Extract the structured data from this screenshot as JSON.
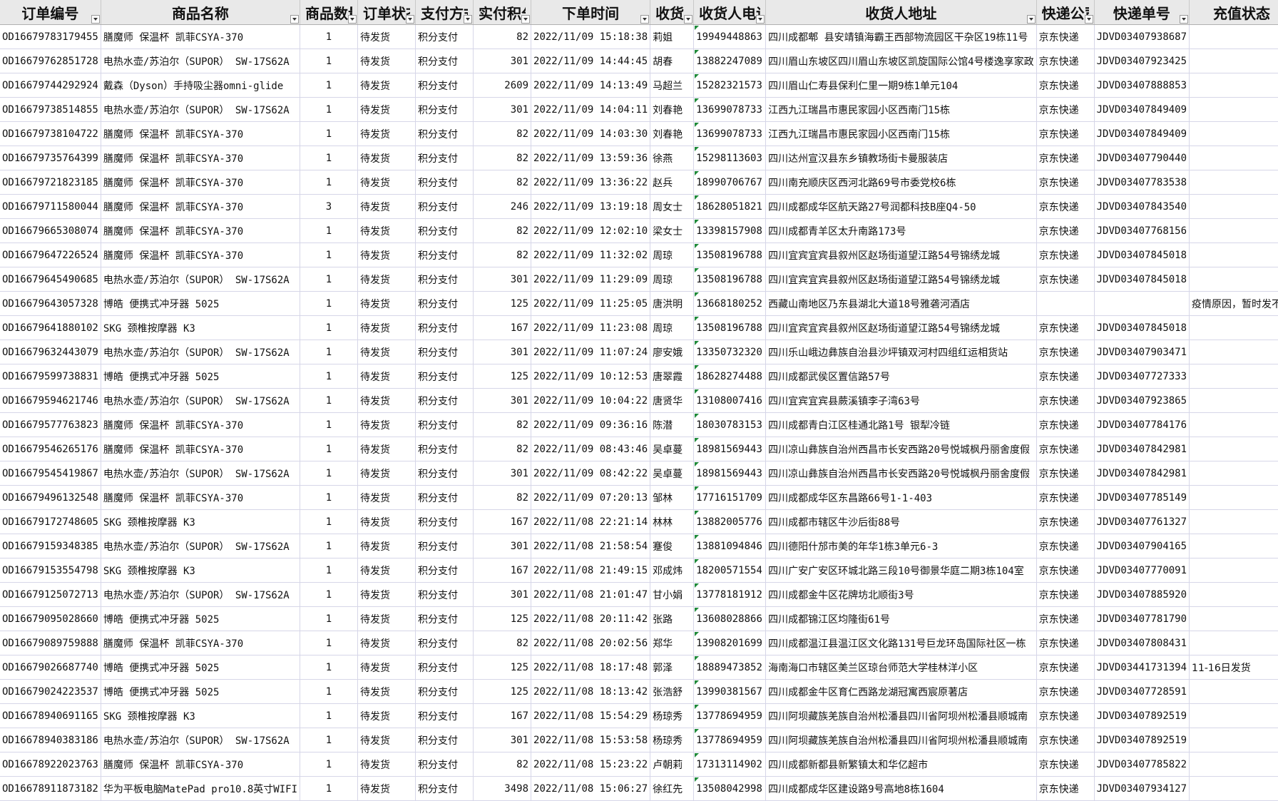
{
  "columns": [
    {
      "key": "order_id",
      "label": "订单编号"
    },
    {
      "key": "product",
      "label": "商品名称"
    },
    {
      "key": "qty",
      "label": "商品数量"
    },
    {
      "key": "status",
      "label": "订单状态"
    },
    {
      "key": "payment",
      "label": "支付方式"
    },
    {
      "key": "points",
      "label": "实付积分"
    },
    {
      "key": "time",
      "label": "下单时间"
    },
    {
      "key": "name",
      "label": "收货人"
    },
    {
      "key": "phone",
      "label": "收货人电话"
    },
    {
      "key": "address",
      "label": "收货人地址"
    },
    {
      "key": "courier",
      "label": "快递公司"
    },
    {
      "key": "tracking",
      "label": "快递单号"
    },
    {
      "key": "recharge",
      "label": "充值状态"
    }
  ],
  "rows": [
    [
      "OD16679783179455",
      "膳魔师 保温杯 凯菲CSYA-370",
      "1",
      "待发货",
      "积分支付",
      "82",
      "2022/11/09 15:18:38",
      "莉姐",
      "19949448863",
      "四川成都郫  县安靖镇海霸王西部物流园区干杂区19栋11号",
      "京东快递",
      "JDVD03407938687",
      ""
    ],
    [
      "OD16679762851728",
      "电热水壶/苏泊尔（SUPOR） SW-17S62A",
      "1",
      "待发货",
      "积分支付",
      "301",
      "2022/11/09 14:44:45",
      "胡春",
      "13882247089",
      "四川眉山东坡区四川眉山东坡区凯旋国际公馆4号楼逸享家政",
      "京东快递",
      "JDVD03407923425",
      ""
    ],
    [
      "OD16679744292924",
      "戴森（Dyson）手持吸尘器omni-glide",
      "1",
      "待发货",
      "积分支付",
      "2609",
      "2022/11/09 14:13:49",
      "马超兰",
      "15282321573",
      "四川眉山仁寿县保利仁里一期9栋1单元104",
      "京东快递",
      "JDVD03407888853",
      ""
    ],
    [
      "OD16679738514855",
      "电热水壶/苏泊尔（SUPOR） SW-17S62A",
      "1",
      "待发货",
      "积分支付",
      "301",
      "2022/11/09 14:04:11",
      "刘春艳",
      "13699078733",
      "江西九江瑞昌市惠民家园小区西南门15栋",
      "京东快递",
      "JDVD03407849409",
      ""
    ],
    [
      "OD16679738104722",
      "膳魔师 保温杯 凯菲CSYA-370",
      "1",
      "待发货",
      "积分支付",
      "82",
      "2022/11/09 14:03:30",
      "刘春艳",
      "13699078733",
      "江西九江瑞昌市惠民家园小区西南门15栋",
      "京东快递",
      "JDVD03407849409",
      ""
    ],
    [
      "OD16679735764399",
      "膳魔师 保温杯 凯菲CSYA-370",
      "1",
      "待发货",
      "积分支付",
      "82",
      "2022/11/09 13:59:36",
      "徐燕",
      "15298113603",
      "四川达州宣汉县东乡镇教场街卡曼服装店",
      "京东快递",
      "JDVD03407790440",
      ""
    ],
    [
      "OD16679721823185",
      "膳魔师 保温杯 凯菲CSYA-370",
      "1",
      "待发货",
      "积分支付",
      "82",
      "2022/11/09 13:36:22",
      "赵兵",
      "18990706767",
      "四川南充顺庆区西河北路69号市委党校6栋",
      "京东快递",
      "JDVD03407783538",
      ""
    ],
    [
      "OD16679711580044",
      "膳魔师 保温杯 凯菲CSYA-370",
      "3",
      "待发货",
      "积分支付",
      "246",
      "2022/11/09 13:19:18",
      "周女士",
      "18628051821",
      "四川成都成华区航天路27号润都科技B座Q4-50",
      "京东快递",
      "JDVD03407843540",
      ""
    ],
    [
      "OD16679665308074",
      "膳魔师 保温杯 凯菲CSYA-370",
      "1",
      "待发货",
      "积分支付",
      "82",
      "2022/11/09 12:02:10",
      "梁女士",
      "13398157908",
      "四川成都青羊区太升南路173号",
      "京东快递",
      "JDVD03407768156",
      ""
    ],
    [
      "OD16679647226524",
      "膳魔师 保温杯 凯菲CSYA-370",
      "1",
      "待发货",
      "积分支付",
      "82",
      "2022/11/09 11:32:02",
      "周琼",
      "13508196788",
      "四川宜宾宜宾县叙州区赵场街道望江路54号锦绣龙城",
      "京东快递",
      "JDVD03407845018",
      ""
    ],
    [
      "OD16679645490685",
      "电热水壶/苏泊尔（SUPOR） SW-17S62A",
      "1",
      "待发货",
      "积分支付",
      "301",
      "2022/11/09 11:29:09",
      "周琼",
      "13508196788",
      "四川宜宾宜宾县叙州区赵场街道望江路54号锦绣龙城",
      "京东快递",
      "JDVD03407845018",
      ""
    ],
    [
      "OD16679643057328",
      "博皓 便携式冲牙器 5025",
      "1",
      "待发货",
      "积分支付",
      "125",
      "2022/11/09 11:25:05",
      "唐洪明",
      "13668180252",
      "西藏山南地区乃东县湖北大道18号雅砻河酒店",
      "",
      "",
      "疫情原因，暂时发不了"
    ],
    [
      "OD16679641880102",
      "SKG 颈椎按摩器 K3",
      "1",
      "待发货",
      "积分支付",
      "167",
      "2022/11/09 11:23:08",
      "周琼",
      "13508196788",
      "四川宜宾宜宾县叙州区赵场街道望江路54号锦绣龙城",
      "京东快递",
      "JDVD03407845018",
      ""
    ],
    [
      "OD16679632443079",
      "电热水壶/苏泊尔（SUPOR） SW-17S62A",
      "1",
      "待发货",
      "积分支付",
      "301",
      "2022/11/09 11:07:24",
      "廖安娥",
      "13350732320",
      "四川乐山峨边彝族自治县沙坪镇双河村四组红运相货站",
      "京东快递",
      "JDVD03407903471",
      ""
    ],
    [
      "OD16679599738831",
      "博皓 便携式冲牙器 5025",
      "1",
      "待发货",
      "积分支付",
      "125",
      "2022/11/09 10:12:53",
      "唐翠霞",
      "18628274488",
      "四川成都武侯区置信路57号",
      "京东快递",
      "JDVD03407727333",
      ""
    ],
    [
      "OD16679594621746",
      "电热水壶/苏泊尔（SUPOR） SW-17S62A",
      "1",
      "待发货",
      "积分支付",
      "301",
      "2022/11/09 10:04:22",
      "唐贤华",
      "13108007416",
      "四川宜宾宜宾县蕨溪镇李子湾63号",
      "京东快递",
      "JDVD03407923865",
      ""
    ],
    [
      "OD16679577763823",
      "膳魔师 保温杯 凯菲CSYA-370",
      "1",
      "待发货",
      "积分支付",
      "82",
      "2022/11/09 09:36:16",
      "陈潜",
      "18030783153",
      "四川成都青白江区桂通北路1号 银犁冷链",
      "京东快递",
      "JDVD03407784176",
      ""
    ],
    [
      "OD16679546265176",
      "膳魔师 保温杯 凯菲CSYA-370",
      "1",
      "待发货",
      "积分支付",
      "82",
      "2022/11/09 08:43:46",
      "吴卓蔓",
      "18981569443",
      "四川凉山彝族自治州西昌市长安西路20号悦城枫丹丽舍度假",
      "京东快递",
      "JDVD03407842981",
      ""
    ],
    [
      "OD16679545419867",
      "电热水壶/苏泊尔（SUPOR） SW-17S62A",
      "1",
      "待发货",
      "积分支付",
      "301",
      "2022/11/09 08:42:22",
      "吴卓蔓",
      "18981569443",
      "四川凉山彝族自治州西昌市长安西路20号悦城枫丹丽舍度假",
      "京东快递",
      "JDVD03407842981",
      ""
    ],
    [
      "OD16679496132548",
      "膳魔师 保温杯 凯菲CSYA-370",
      "1",
      "待发货",
      "积分支付",
      "82",
      "2022/11/09 07:20:13",
      "邹林",
      "17716151709",
      "四川成都成华区东昌路66号1-1-403",
      "京东快递",
      "JDVD03407785149",
      ""
    ],
    [
      "OD16679172748605",
      "SKG 颈椎按摩器 K3",
      "1",
      "待发货",
      "积分支付",
      "167",
      "2022/11/08 22:21:14",
      "林林",
      "13882005776",
      "四川成都市辖区牛沙后街88号",
      "京东快递",
      "JDVD03407761327",
      ""
    ],
    [
      "OD16679159348385",
      "电热水壶/苏泊尔（SUPOR） SW-17S62A",
      "1",
      "待发货",
      "积分支付",
      "301",
      "2022/11/08 21:58:54",
      "蹇俊",
      "13881094846",
      "四川德阳什邡市美的年华1栋3单元6-3",
      "京东快递",
      "JDVD03407904165",
      ""
    ],
    [
      "OD16679153554798",
      "SKG 颈椎按摩器 K3",
      "1",
      "待发货",
      "积分支付",
      "167",
      "2022/11/08 21:49:15",
      "邓成炜",
      "18200571554",
      "四川广安广安区环城北路三段10号御景华庭二期3栋104室",
      "京东快递",
      "JDVD03407770091",
      ""
    ],
    [
      "OD16679125072713",
      "电热水壶/苏泊尔（SUPOR） SW-17S62A",
      "1",
      "待发货",
      "积分支付",
      "301",
      "2022/11/08 21:01:47",
      "甘小娟",
      "13778181912",
      "四川成都金牛区花牌坊北顺街3号",
      "京东快递",
      "JDVD03407885920",
      ""
    ],
    [
      "OD16679095028660",
      "博皓 便携式冲牙器 5025",
      "1",
      "待发货",
      "积分支付",
      "125",
      "2022/11/08 20:11:42",
      "张路",
      "13608028866",
      "四川成都锦江区均隆街61号",
      "京东快递",
      "JDVD03407781790",
      ""
    ],
    [
      "OD16679089759888",
      "膳魔师 保温杯 凯菲CSYA-370",
      "1",
      "待发货",
      "积分支付",
      "82",
      "2022/11/08 20:02:56",
      "郑华",
      "13908201699",
      "四川成都温江县温江区文化路131号巨龙环岛国际社区一栋",
      "京东快递",
      "JDVD03407808431",
      ""
    ],
    [
      "OD16679026687740",
      "博皓 便携式冲牙器 5025",
      "1",
      "待发货",
      "积分支付",
      "125",
      "2022/11/08 18:17:48",
      "郭泽",
      "18889473852",
      "海南海口市辖区美兰区琼台师范大学桂林洋小区",
      "京东快递",
      "JDVD03441731394",
      "11-16日发货"
    ],
    [
      "OD16679024223537",
      "博皓 便携式冲牙器 5025",
      "1",
      "待发货",
      "积分支付",
      "125",
      "2022/11/08 18:13:42",
      "张浩舒",
      "13990381567",
      "四川成都金牛区育仁西路龙湖冠寓西宸原著店",
      "京东快递",
      "JDVD03407728591",
      ""
    ],
    [
      "OD16678940691165",
      "SKG 颈椎按摩器 K3",
      "1",
      "待发货",
      "积分支付",
      "167",
      "2022/11/08 15:54:29",
      "杨琼秀",
      "13778694959",
      "四川阿坝藏族羌族自治州松潘县四川省阿坝州松潘县顺城南",
      "京东快递",
      "JDVD03407892519",
      ""
    ],
    [
      "OD16678940383186",
      "电热水壶/苏泊尔（SUPOR） SW-17S62A",
      "1",
      "待发货",
      "积分支付",
      "301",
      "2022/11/08 15:53:58",
      "杨琼秀",
      "13778694959",
      "四川阿坝藏族羌族自治州松潘县四川省阿坝州松潘县顺城南",
      "京东快递",
      "JDVD03407892519",
      ""
    ],
    [
      "OD16678922023763",
      "膳魔师 保温杯 凯菲CSYA-370",
      "1",
      "待发货",
      "积分支付",
      "82",
      "2022/11/08 15:23:22",
      "卢朝莉",
      "17313114902",
      "四川成都新都县新繁镇太和华亿超市",
      "京东快递",
      "JDVD03407785822",
      ""
    ],
    [
      "OD16678911873182",
      "华为平板电脑MatePad pro10.8英寸WIFI",
      "1",
      "待发货",
      "积分支付",
      "3498",
      "2022/11/08 15:06:27",
      "徐红先",
      "13508042998",
      "四川成都成华区建设路9号高地8栋1604",
      "京东快递",
      "JDVD03407934127",
      ""
    ]
  ]
}
